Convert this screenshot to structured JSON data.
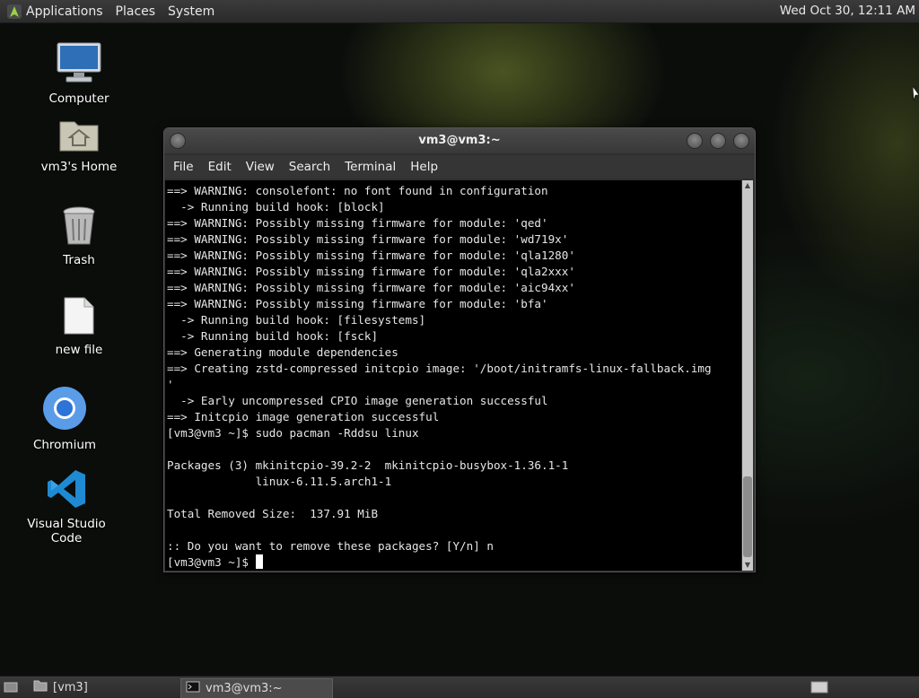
{
  "top_panel": {
    "menus": [
      "Applications",
      "Places",
      "System"
    ],
    "clock": "Wed Oct 30, 12:11 AM"
  },
  "desktop_icons": [
    {
      "label": "Computer",
      "icon": "computer-icon"
    },
    {
      "label": "vm3's Home",
      "icon": "home-folder-icon"
    },
    {
      "label": "Trash",
      "icon": "trash-icon"
    },
    {
      "label": "new file",
      "icon": "file-icon"
    },
    {
      "label": "Chromium",
      "icon": "chromium-icon"
    },
    {
      "label": "Visual Studio Code",
      "icon": "vscode-icon"
    }
  ],
  "terminal": {
    "title": "vm3@vm3:~",
    "menus": [
      "File",
      "Edit",
      "View",
      "Search",
      "Terminal",
      "Help"
    ],
    "lines": [
      "==> WARNING: consolefont: no font found in configuration",
      "  -> Running build hook: [block]",
      "==> WARNING: Possibly missing firmware for module: 'qed'",
      "==> WARNING: Possibly missing firmware for module: 'wd719x'",
      "==> WARNING: Possibly missing firmware for module: 'qla1280'",
      "==> WARNING: Possibly missing firmware for module: 'qla2xxx'",
      "==> WARNING: Possibly missing firmware for module: 'aic94xx'",
      "==> WARNING: Possibly missing firmware for module: 'bfa'",
      "  -> Running build hook: [filesystems]",
      "  -> Running build hook: [fsck]",
      "==> Generating module dependencies",
      "==> Creating zstd-compressed initcpio image: '/boot/initramfs-linux-fallback.img",
      "'",
      "  -> Early uncompressed CPIO image generation successful",
      "==> Initcpio image generation successful",
      "[vm3@vm3 ~]$ sudo pacman -Rddsu linux",
      "",
      "Packages (3) mkinitcpio-39.2-2  mkinitcpio-busybox-1.36.1-1",
      "             linux-6.11.5.arch1-1",
      "",
      "Total Removed Size:  137.91 MiB",
      "",
      ":: Do you want to remove these packages? [Y/n] n"
    ],
    "prompt": "[vm3@vm3 ~]$ "
  },
  "taskbar": {
    "items": [
      {
        "label": "[vm3]",
        "icon": "folder-icon"
      },
      {
        "label": "vm3@vm3:~",
        "icon": "terminal-icon"
      }
    ]
  }
}
